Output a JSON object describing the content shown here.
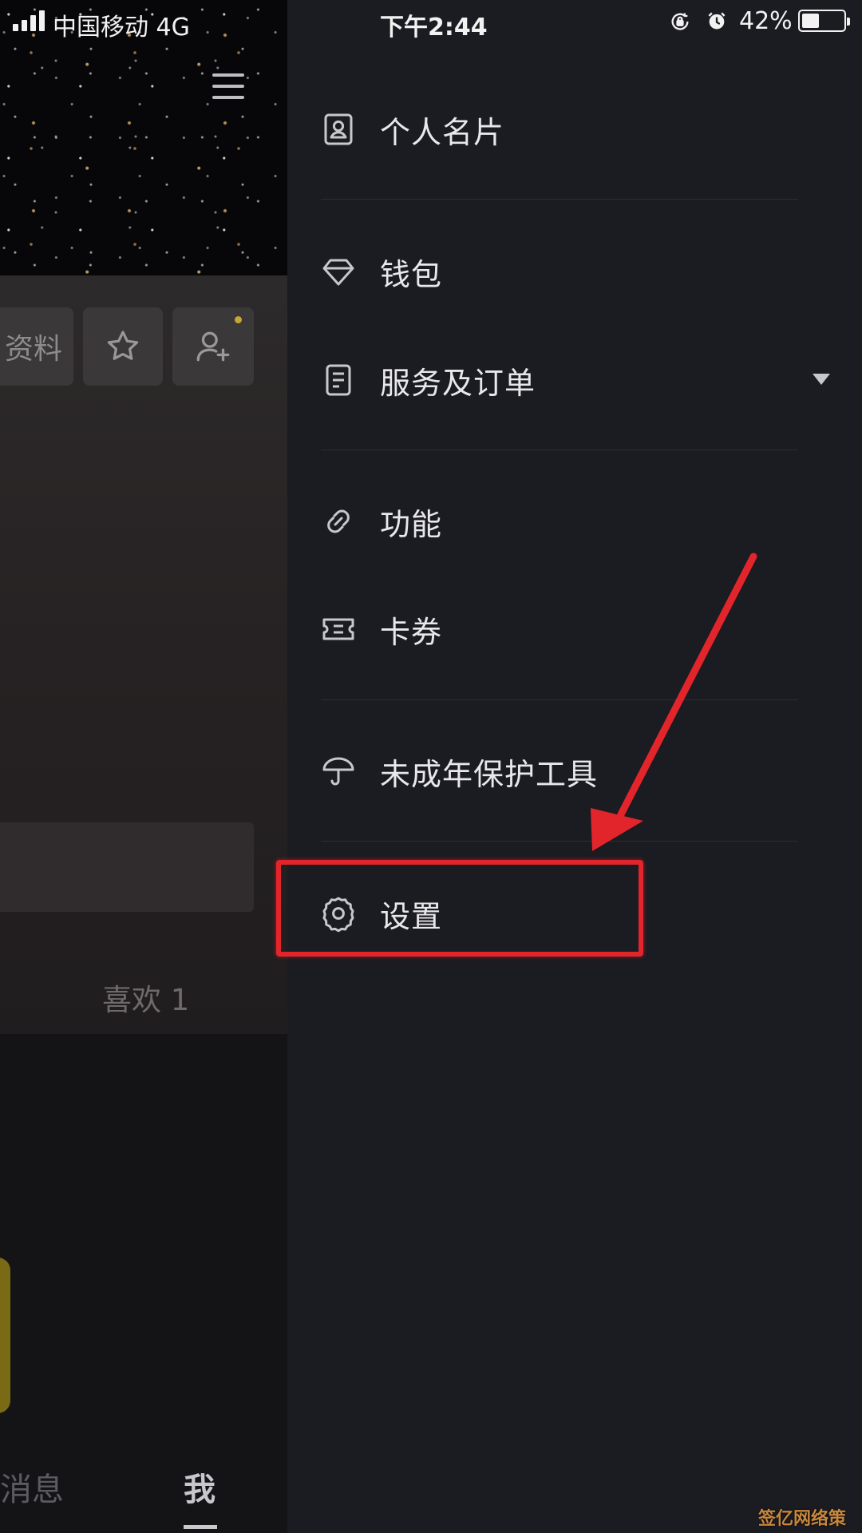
{
  "status_bar": {
    "carrier": "中国移动  4G",
    "time": "下午2:44",
    "battery": "42%",
    "battery_level": 0.42
  },
  "background_page": {
    "edit_profile_label": "资料",
    "likes_label": "喜欢 1",
    "tabs": {
      "messages": "消息",
      "me": "我"
    }
  },
  "menu": {
    "items": [
      {
        "label": "个人名片",
        "icon": "id-card-icon"
      },
      {
        "label": "钱包",
        "icon": "diamond-icon"
      },
      {
        "label": "服务及订单",
        "icon": "document-list-icon"
      },
      {
        "label": "功能",
        "icon": "link-icon"
      },
      {
        "label": "卡券",
        "icon": "ticket-icon"
      },
      {
        "label": "未成年保护工具",
        "icon": "umbrella-icon"
      },
      {
        "label": "设置",
        "icon": "gear-icon"
      }
    ]
  },
  "annotation": {
    "color": "#e2252b"
  },
  "watermark": "签亿网络策划"
}
